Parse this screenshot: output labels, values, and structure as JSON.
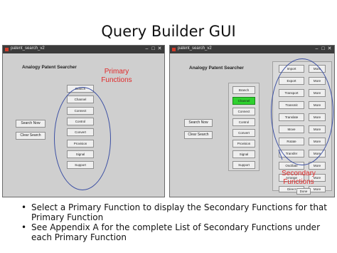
{
  "slide": {
    "title": "Query Builder GUI"
  },
  "left_window": {
    "title": "patent_search_v2",
    "heading": "Analogy Patent Searcher",
    "primary_functions": [
      "Branch",
      "Channel",
      "Connect",
      "Control",
      "Convert",
      "Provision",
      "Signal",
      "Support"
    ],
    "search_button": "Search Now",
    "clear_button": "Clear Search",
    "annotation": "Primary\nFunctions"
  },
  "right_window": {
    "title": "patent_search_v2",
    "heading": "Analogy Patent Searcher",
    "primary_functions": [
      "Branch",
      "Channel",
      "Connect",
      "Control",
      "Convert",
      "Provision",
      "Signal",
      "Support"
    ],
    "selected_primary": "Channel",
    "secondary_functions": [
      "Import",
      "Export",
      "Transport",
      "Transmit",
      "Translate",
      "Move",
      "Rotate",
      "Transfer",
      "Oscillate",
      "Arrange",
      "Direct"
    ],
    "more_label": "More",
    "search_button": "Search Now",
    "clear_button": "Clear Search",
    "done_button": "Done",
    "annotation": "Secondary\nFunctions"
  },
  "bullets": [
    "Select a Primary Function to display the Secondary Functions for that Primary Function",
    "See Appendix A for the complete List of Secondary Functions under each Primary Function"
  ],
  "colors": {
    "annotation": "#e02a2a",
    "oval": "#3b4fa3",
    "selected": "#2fd12f",
    "titlebar": "#3b3b3b"
  }
}
